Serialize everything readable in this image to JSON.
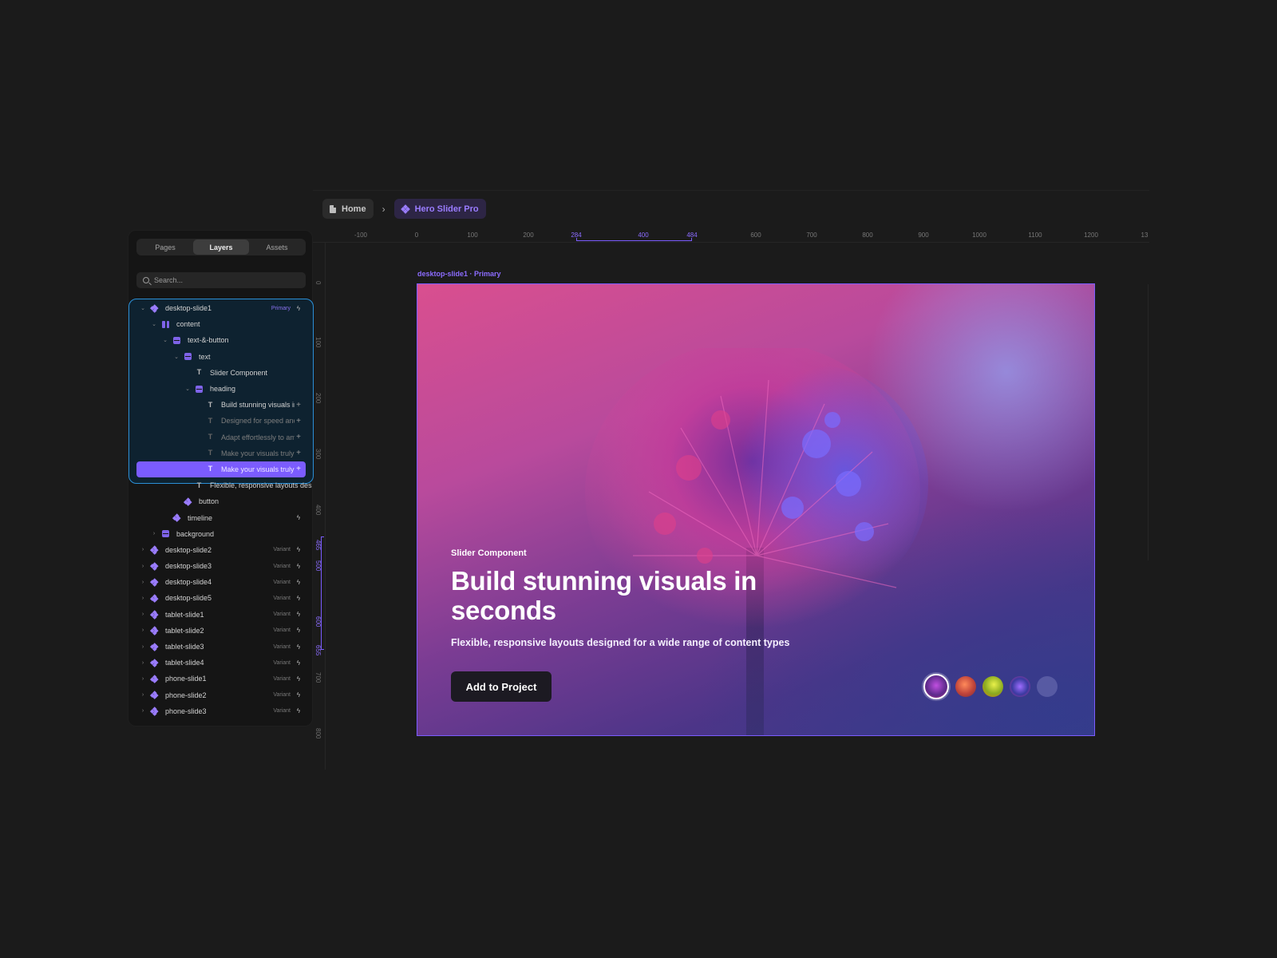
{
  "breadcrumb": {
    "home_label": "Home",
    "home_icon": "file-icon",
    "separator": "›",
    "current_label": "Hero Slider Pro",
    "current_icon": "component-icon"
  },
  "panel": {
    "tabs": [
      {
        "label": "Pages",
        "active": false
      },
      {
        "label": "Layers",
        "active": true
      },
      {
        "label": "Assets",
        "active": false
      }
    ],
    "search": {
      "value": "",
      "placeholder": "Search..."
    },
    "layers": [
      {
        "label": "desktop-slide1",
        "icon": "component-icon",
        "expanded": true,
        "tag": "Primary",
        "bolt": true
      },
      {
        "label": "content",
        "icon": "columns-icon",
        "expanded": true
      },
      {
        "label": "text-&-button",
        "icon": "stack-icon",
        "expanded": true
      },
      {
        "label": "text",
        "icon": "stack-icon",
        "expanded": true
      },
      {
        "label": "Slider Component",
        "icon": "text-icon"
      },
      {
        "label": "heading",
        "icon": "stack-icon",
        "expanded": true
      },
      {
        "label": "Build stunning visuals ir",
        "icon": "text-icon",
        "plus": true
      },
      {
        "label": "Designed for speed and",
        "icon": "text-icon",
        "plus": true,
        "dim": true
      },
      {
        "label": "Adapt effortlessly to am",
        "icon": "text-icon",
        "plus": true,
        "dim": true
      },
      {
        "label": "Make your visuals truly",
        "icon": "text-icon",
        "plus": true,
        "dim": true
      },
      {
        "label": "Make your visuals truly",
        "icon": "text-icon",
        "plus": true,
        "highlight": true
      },
      {
        "label": "Flexible, responsive layouts des",
        "icon": "text-icon"
      },
      {
        "label": "button",
        "icon": "component-icon"
      },
      {
        "label": "timeline",
        "icon": "component-icon",
        "bolt": true
      },
      {
        "label": "background",
        "icon": "stack-icon",
        "collapsed": true
      },
      {
        "label": "desktop-slide2",
        "icon": "component-icon",
        "collapsed": true,
        "tag": "Variant",
        "bolt": true
      },
      {
        "label": "desktop-slide3",
        "icon": "component-icon",
        "collapsed": true,
        "tag": "Variant",
        "bolt": true
      },
      {
        "label": "desktop-slide4",
        "icon": "component-icon",
        "collapsed": true,
        "tag": "Variant",
        "bolt": true
      },
      {
        "label": "desktop-slide5",
        "icon": "component-icon",
        "collapsed": true,
        "tag": "Variant",
        "bolt": true
      },
      {
        "label": "tablet-slide1",
        "icon": "component-icon",
        "collapsed": true,
        "tag": "Variant",
        "bolt": true
      },
      {
        "label": "tablet-slide2",
        "icon": "component-icon",
        "collapsed": true,
        "tag": "Variant",
        "bolt": true
      },
      {
        "label": "tablet-slide3",
        "icon": "component-icon",
        "collapsed": true,
        "tag": "Variant",
        "bolt": true
      },
      {
        "label": "tablet-slide4",
        "icon": "component-icon",
        "collapsed": true,
        "tag": "Variant",
        "bolt": true
      },
      {
        "label": "phone-slide1",
        "icon": "component-icon",
        "collapsed": true,
        "tag": "Variant",
        "bolt": true
      },
      {
        "label": "phone-slide2",
        "icon": "component-icon",
        "collapsed": true,
        "tag": "Variant",
        "bolt": true
      },
      {
        "label": "phone-slide3",
        "icon": "component-icon",
        "collapsed": true,
        "tag": "Variant",
        "bolt": true
      }
    ]
  },
  "rulers": {
    "top_ticks": [
      "-100",
      "0",
      "100",
      "200",
      "284",
      "400",
      "484",
      "600",
      "700",
      "800",
      "900",
      "1000",
      "1100",
      "1200",
      "13"
    ],
    "top_highlight": [
      "284",
      "400",
      "484"
    ],
    "left_ticks": [
      "0",
      "100",
      "200",
      "300",
      "400",
      "465",
      "500",
      "600",
      "655",
      "700",
      "800"
    ],
    "left_highlight": [
      "465",
      "500",
      "600",
      "655"
    ]
  },
  "canvas": {
    "frame_label": "desktop-slide1 · Primary",
    "slide": {
      "subheading": "Slider Component",
      "heading": "Build stunning visuals in seconds",
      "description": "Flexible, responsive layouts designed for a wide range of content types",
      "button_label": "Add to Project",
      "thumbnails": [
        {
          "name": "purple-flower",
          "active": true
        },
        {
          "name": "orange-flower",
          "active": false
        },
        {
          "name": "yellow-leaf",
          "active": false
        },
        {
          "name": "blue-flower",
          "active": false
        },
        {
          "name": "empty",
          "active": false
        }
      ]
    }
  },
  "colors": {
    "accent": "#7b5cff",
    "selection_border": "#2b8fd6",
    "background": "#1b1b1b",
    "panel": "#151515"
  }
}
